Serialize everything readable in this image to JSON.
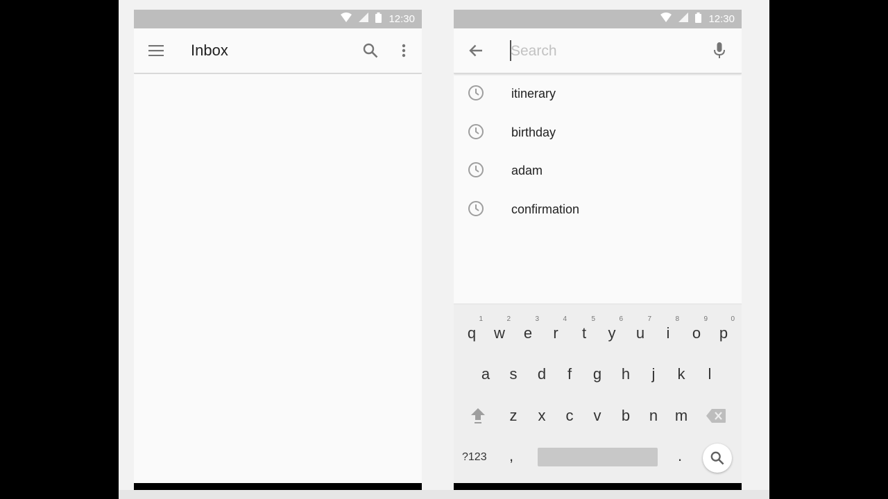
{
  "status_bar": {
    "time": "12:30"
  },
  "inbox_screen": {
    "title": "Inbox"
  },
  "search_screen": {
    "placeholder": "Search",
    "recent_searches": [
      "itinerary",
      "birthday",
      "adam",
      "confirmation"
    ]
  },
  "keyboard": {
    "row1": [
      {
        "key": "q",
        "hint": "1"
      },
      {
        "key": "w",
        "hint": "2"
      },
      {
        "key": "e",
        "hint": "3"
      },
      {
        "key": "r",
        "hint": "4"
      },
      {
        "key": "t",
        "hint": "5"
      },
      {
        "key": "y",
        "hint": "6"
      },
      {
        "key": "u",
        "hint": "7"
      },
      {
        "key": "i",
        "hint": "8"
      },
      {
        "key": "o",
        "hint": "9"
      },
      {
        "key": "p",
        "hint": "0"
      }
    ],
    "row2": [
      "a",
      "s",
      "d",
      "f",
      "g",
      "h",
      "j",
      "k",
      "l"
    ],
    "row3": [
      "z",
      "x",
      "c",
      "v",
      "b",
      "n",
      "m"
    ],
    "symbols_label": "?123",
    "comma": ",",
    "period": "."
  },
  "icons": {
    "menu": "menu-icon",
    "search": "search-icon",
    "overflow": "more-vert-icon",
    "back": "arrow-back-icon",
    "mic": "mic-icon",
    "recent": "clock-icon",
    "shift": "shift-icon",
    "backspace": "backspace-icon",
    "wifi": "wifi-icon",
    "signal": "signal-icon",
    "battery": "battery-icon"
  },
  "colors": {
    "status_bar": "#bdbdbd",
    "surface": "#fafafa",
    "icon": "#757575",
    "text_primary": "#212121",
    "placeholder": "#c2c2c2",
    "keyboard_bg": "#eeeeee"
  }
}
